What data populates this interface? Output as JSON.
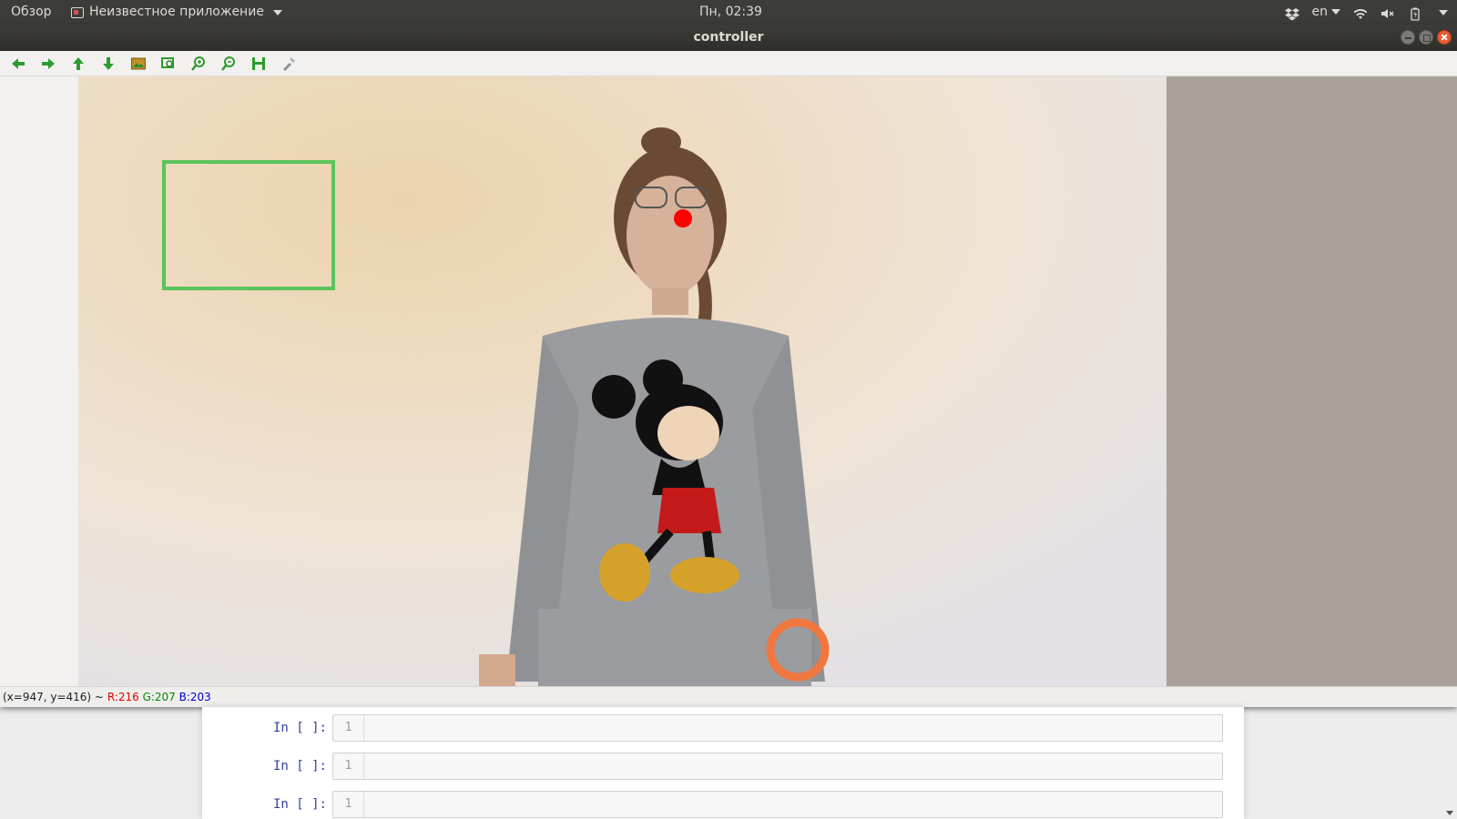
{
  "topbar": {
    "overview": "Обзор",
    "app_name": "Неизвестное приложение",
    "clock": "Пн, 02:39",
    "language": "en",
    "tray_icons": [
      "dropbox-icon",
      "wifi-icon",
      "volume-muted-icon",
      "battery-icon",
      "system-menu-icon"
    ]
  },
  "window": {
    "title": "controller",
    "toolbar": [
      {
        "name": "back-icon",
        "color": "#2e9b2e"
      },
      {
        "name": "forward-icon",
        "color": "#2e9b2e"
      },
      {
        "name": "up-icon",
        "color": "#2e9b2e"
      },
      {
        "name": "down-icon",
        "color": "#2e9b2e"
      },
      {
        "name": "image-icon",
        "color": "#c06000"
      },
      {
        "name": "zoom-fit-icon",
        "color": "#2e9b2e"
      },
      {
        "name": "zoom-in-icon",
        "color": "#2e9b2e"
      },
      {
        "name": "zoom-out-icon",
        "color": "#2e9b2e"
      },
      {
        "name": "save-icon",
        "color": "#2e9b2e"
      },
      {
        "name": "properties-icon",
        "color": "#808080"
      }
    ],
    "overlay": {
      "roi_color": "#5ac35a",
      "marker_color": "#ff0000"
    },
    "status": {
      "coords": "(x=947, y=416) ~",
      "r": "R:216",
      "g": "G:207",
      "b": "B:203"
    }
  },
  "notebook": {
    "cells": [
      {
        "prompt": "In [ ]:",
        "line": "1"
      },
      {
        "prompt": "In [ ]:",
        "line": "1"
      },
      {
        "prompt": "In [ ]:",
        "line": "1"
      }
    ]
  }
}
